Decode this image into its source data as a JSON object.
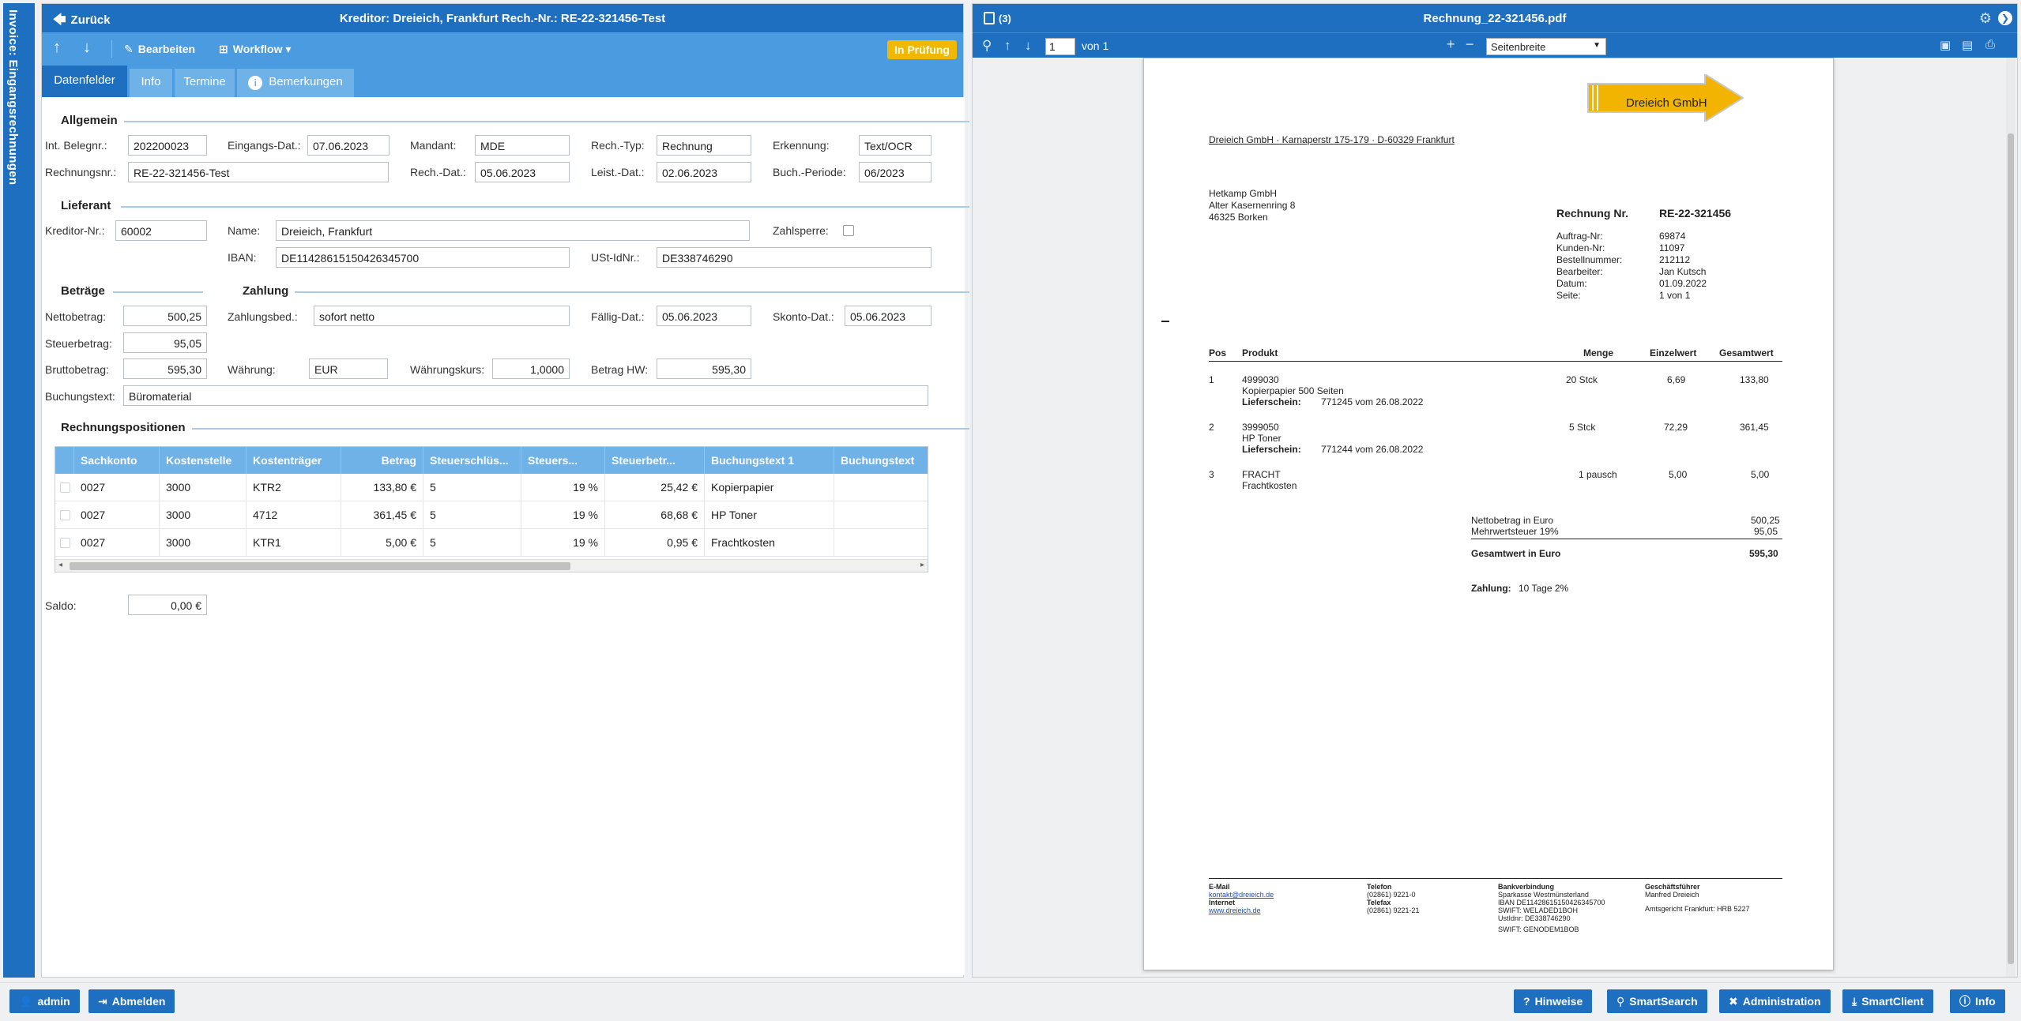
{
  "sidebar": {
    "label": "Invoice: Eingangsrechnungen"
  },
  "left": {
    "back_label": "Zurück",
    "title": "Kreditor: Dreieich, Frankfurt Rech.-Nr.: RE-22-321456-Test",
    "toolbar": {
      "edit_label": "Bearbeiten",
      "workflow_label": "Workflow",
      "status": "In Prüfung"
    },
    "tabs": [
      "Datenfelder",
      "Info",
      "Termine",
      "Bemerkungen"
    ],
    "sections": {
      "allgemein": "Allgemein",
      "lieferant": "Lieferant",
      "betraege": "Beträge",
      "zahlung": "Zahlung",
      "positionen": "Rechnungspositionen"
    },
    "fields": {
      "int_belegnr": {
        "label": "Int. Belegnr.:",
        "value": "202200023"
      },
      "eingangs_dat": {
        "label": "Eingangs-Dat.:",
        "value": "07.06.2023"
      },
      "mandant": {
        "label": "Mandant:",
        "value": "MDE"
      },
      "rech_typ": {
        "label": "Rech.-Typ:",
        "value": "Rechnung"
      },
      "erkennung": {
        "label": "Erkennung:",
        "value": "Text/OCR"
      },
      "rechnungsnr": {
        "label": "Rechnungsnr.:",
        "value": "RE-22-321456-Test"
      },
      "rech_dat": {
        "label": "Rech.-Dat.:",
        "value": "05.06.2023"
      },
      "leist_dat": {
        "label": "Leist.-Dat.:",
        "value": "02.06.2023"
      },
      "buch_periode": {
        "label": "Buch.-Periode:",
        "value": "06/2023"
      },
      "kreditor_nr": {
        "label": "Kreditor-Nr.:",
        "value": "60002"
      },
      "name": {
        "label": "Name:",
        "value": "Dreieich, Frankfurt"
      },
      "zahlsperre": {
        "label": "Zahlsperre:"
      },
      "iban": {
        "label": "IBAN:",
        "value": "DE11428615150426345700"
      },
      "ust_idnr": {
        "label": "USt-IdNr.:",
        "value": "DE338746290"
      },
      "nettobetrag": {
        "label": "Nettobetrag:",
        "value": "500,25"
      },
      "zahlungsbed": {
        "label": "Zahlungsbed.:",
        "value": "sofort netto"
      },
      "faellig_dat": {
        "label": "Fällig-Dat.:",
        "value": "05.06.2023"
      },
      "skonto_dat": {
        "label": "Skonto-Dat.:",
        "value": "05.06.2023"
      },
      "steuerbetrag": {
        "label": "Steuerbetrag:",
        "value": "95,05"
      },
      "bruttobetrag": {
        "label": "Bruttobetrag:",
        "value": "595,30"
      },
      "waehrung": {
        "label": "Währung:",
        "value": "EUR"
      },
      "waehrungskurs": {
        "label": "Währungskurs:",
        "value": "1,0000"
      },
      "betrag_hw": {
        "label": "Betrag HW:",
        "value": "595,30"
      },
      "buchungstext": {
        "label": "Buchungstext:",
        "value": "Büromaterial"
      },
      "saldo": {
        "label": "Saldo:",
        "value": "0,00 €"
      }
    },
    "grid": {
      "columns": [
        "Sachkonto",
        "Kostenstelle",
        "Kostenträger",
        "Betrag",
        "Steuerschlüs...",
        "Steuers...",
        "Steuerbetr...",
        "Buchungstext 1",
        "Buchungstext"
      ],
      "rows": [
        [
          "0027",
          "3000",
          "KTR2",
          "133,80 €",
          "5",
          "19 %",
          "25,42 €",
          "Kopierpapier",
          ""
        ],
        [
          "0027",
          "3000",
          "4712",
          "361,45 €",
          "5",
          "19 %",
          "68,68 €",
          "HP Toner",
          ""
        ],
        [
          "0027",
          "3000",
          "KTR1",
          "5,00 €",
          "5",
          "19 %",
          "0,95 €",
          "Frachtkosten",
          ""
        ]
      ]
    }
  },
  "right": {
    "count": "(3)",
    "title": "Rechnung_22-321456.pdf",
    "toolbar": {
      "page": "1",
      "of": "von 1",
      "zoom": "Seitenbreite"
    },
    "pdf": {
      "logo": "Dreieich GmbH",
      "sender_line": "Dreieich GmbH · Karnaperstr 175-179 · D-60329 Frankfurt",
      "recipient": [
        "Hetkamp GmbH",
        "Alter Kasernenring 8",
        "46325 Borken"
      ],
      "invoice_label": "Rechnung Nr.",
      "invoice_no": "RE-22-321456",
      "meta_labels": [
        "Auftrag-Nr:",
        "Kunden-Nr:",
        "Bestellnummer:",
        "Bearbeiter:",
        "Datum:",
        "Seite:"
      ],
      "meta_values": [
        "69874",
        "11097",
        "212112",
        "Jan Kutsch",
        "01.09.2022",
        "1 von 1"
      ],
      "table_headers": [
        "Pos",
        "Produkt",
        "Menge",
        "Einzelwert",
        "Gesamtwert"
      ],
      "items": [
        {
          "pos": "1",
          "nr": "4999030",
          "desc": "Kopierpapier 500 Seiten",
          "ls_label": "Lieferschein:",
          "ls": "771245 vom 26.08.2022",
          "qty": "20 Stck",
          "unit": "6,69",
          "total": "133,80"
        },
        {
          "pos": "2",
          "nr": "3999050",
          "desc": "HP Toner",
          "ls_label": "Lieferschein:",
          "ls": "771244 vom 26.08.2022",
          "qty": "5 Stck",
          "unit": "72,29",
          "total": "361,45"
        },
        {
          "pos": "3",
          "nr": "FRACHT",
          "desc": "Frachtkosten",
          "ls_label": "",
          "ls": "",
          "qty": "1 pausch",
          "unit": "5,00",
          "total": "5,00"
        }
      ],
      "net_label": "Nettobetrag in Euro",
      "net": "500,25",
      "vat_label": "Mehrwertsteuer 19%",
      "vat": "95,05",
      "total_label": "Gesamtwert in Euro",
      "total": "595,30",
      "payment_label": "Zahlung:",
      "payment": "10 Tage 2%",
      "footer": {
        "email_label": "E-Mail",
        "email": "kontakt@dreieich.de",
        "internet_label": "Internet",
        "internet": "www.dreieich.de",
        "phone_label": "Telefon",
        "phone": "(02861) 9221-0",
        "fax_label": "Telefax",
        "fax": "(02861) 9221-21",
        "bank_label": "Bankverbindung",
        "bank": [
          "Sparkasse Westmünsterland",
          "IBAN DE11428615150426345700",
          "SWIFT: WELADED1BOH",
          "UstIdnr: DE338746290",
          "SWIFT: GENODEM1BOB"
        ],
        "gf_label": "Geschäftsführer",
        "gf": "Manfred Dreieich",
        "court": "Amtsgericht Frankfurt: HRB 5227"
      }
    }
  },
  "bottom": {
    "user": "admin",
    "logout": "Abmelden",
    "buttons": [
      "Hinweise",
      "SmartSearch",
      "Administration",
      "SmartClient",
      "Info"
    ]
  }
}
